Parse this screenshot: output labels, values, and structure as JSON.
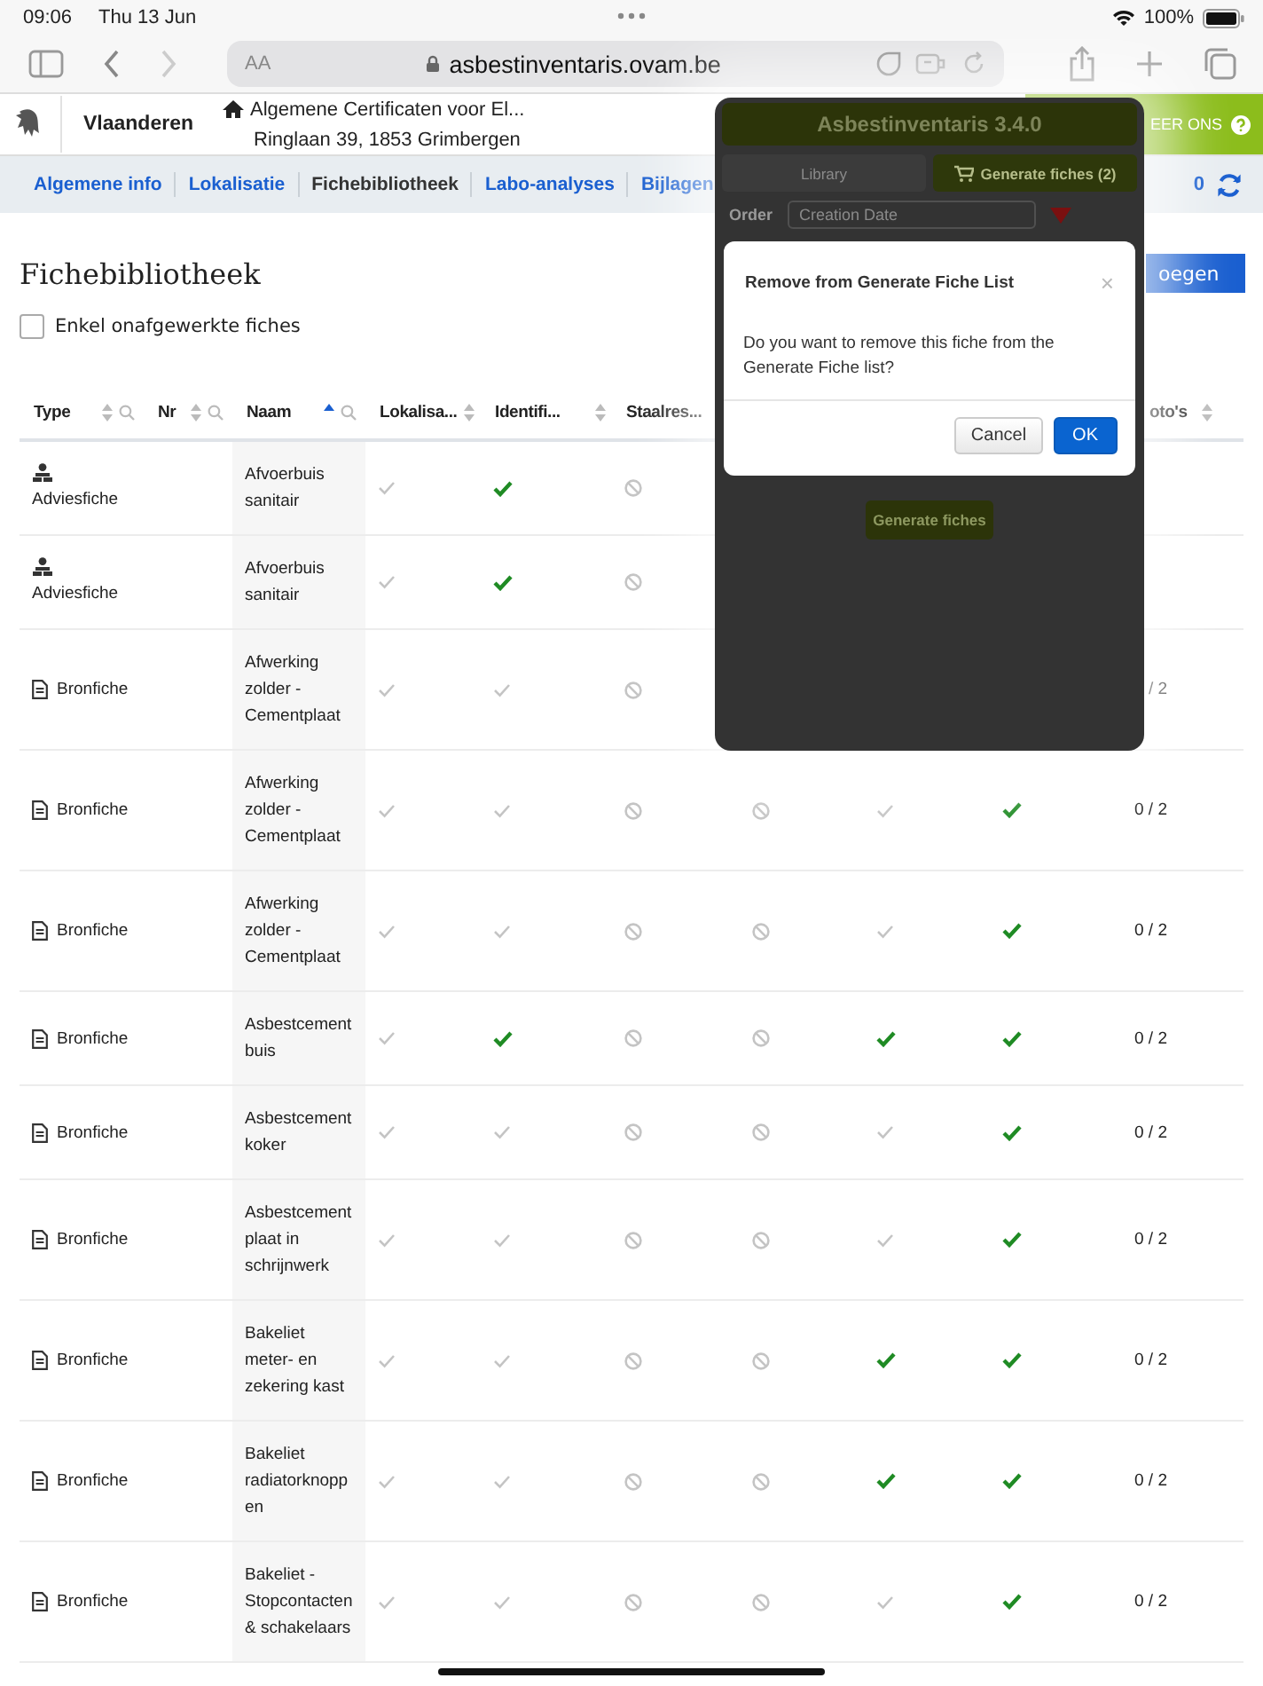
{
  "status_bar": {
    "time": "09:06",
    "date": "Thu 13 Jun",
    "battery": "100%"
  },
  "browser": {
    "text_size_button": "AA",
    "url": "asbestinventaris.ovam.be"
  },
  "site_header": {
    "brand": "Vlaanderen",
    "breadcrumb": [
      "Algemene Certificaten voor El...",
      "Ringlaan 39, 1853 Grimbergen"
    ],
    "contact_button": "EER ONS"
  },
  "tabs": [
    {
      "label": "Algemene info",
      "selected": false
    },
    {
      "label": "Lokalisatie",
      "selected": false
    },
    {
      "label": "Fichebibliotheek",
      "selected": true
    },
    {
      "label": "Labo-analyses",
      "selected": false
    },
    {
      "label": "Bijlagen",
      "selected": false
    }
  ],
  "sync": {
    "count": "0"
  },
  "page": {
    "title": "Fichebibliotheek",
    "add_button": "oegen",
    "filter": {
      "label": "Enkel onafgewerkte fiches",
      "checked": false
    }
  },
  "table": {
    "columns": [
      {
        "label": "Type",
        "sorted": false,
        "search": true
      },
      {
        "label": "Nr",
        "sorted": false,
        "search": true
      },
      {
        "label": "Naam",
        "sorted": true,
        "search": true
      },
      {
        "label": "Lokalisa...",
        "sorted": false,
        "search": false
      },
      {
        "label": "Identifi...",
        "sorted": false,
        "search": false
      },
      {
        "label": "Staalres...",
        "search": false
      },
      {
        "label": "oto's",
        "sorted": false,
        "search": false
      }
    ],
    "rows": [
      {
        "kind": "advies",
        "type": "Adviesfiche",
        "naam": "Afvoerbuis sanitair",
        "marks": [
          {
            "kind": "check",
            "done": false
          },
          {
            "kind": "check",
            "done": true
          },
          {
            "kind": "not_applicable"
          }
        ]
      },
      {
        "kind": "advies",
        "type": "Adviesfiche",
        "naam": "Afvoerbuis sanitair",
        "marks": [
          {
            "kind": "check",
            "done": false
          },
          {
            "kind": "check",
            "done": true
          },
          {
            "kind": "not_applicable"
          }
        ]
      },
      {
        "kind": "bron",
        "type": "Bronfiche",
        "naam": "Afwerking zolder - Cementplaat",
        "marks": [
          {
            "kind": "check",
            "done": false
          },
          {
            "kind": "check",
            "done": false
          },
          {
            "kind": "not_applicable"
          }
        ],
        "fotos": "/ 2"
      },
      {
        "kind": "bron",
        "type": "Bronfiche",
        "naam": "Afwerking zolder - Cementplaat",
        "marks": [
          {
            "kind": "check",
            "done": false
          },
          {
            "kind": "check",
            "done": false
          },
          {
            "kind": "not_applicable"
          },
          {
            "kind": "not_applicable"
          },
          {
            "kind": "check",
            "done": false
          },
          {
            "kind": "check",
            "done": true
          }
        ],
        "fotos": "0 / 2"
      },
      {
        "kind": "bron",
        "type": "Bronfiche",
        "naam": "Afwerking zolder - Cementplaat",
        "marks": [
          {
            "kind": "check",
            "done": false
          },
          {
            "kind": "check",
            "done": false
          },
          {
            "kind": "not_applicable"
          },
          {
            "kind": "not_applicable"
          },
          {
            "kind": "check",
            "done": false
          },
          {
            "kind": "check",
            "done": true
          }
        ],
        "fotos": "0 / 2"
      },
      {
        "kind": "bron",
        "type": "Bronfiche",
        "naam": "Asbestcementbuis",
        "marks": [
          {
            "kind": "check",
            "done": false
          },
          {
            "kind": "check",
            "done": true
          },
          {
            "kind": "not_applicable"
          },
          {
            "kind": "not_applicable"
          },
          {
            "kind": "check",
            "done": true
          },
          {
            "kind": "check",
            "done": true
          }
        ],
        "fotos": "0 / 2"
      },
      {
        "kind": "bron",
        "type": "Bronfiche",
        "naam": "Asbestcementkoker",
        "marks": [
          {
            "kind": "check",
            "done": false
          },
          {
            "kind": "check",
            "done": false
          },
          {
            "kind": "not_applicable"
          },
          {
            "kind": "not_applicable"
          },
          {
            "kind": "check",
            "done": false
          },
          {
            "kind": "check",
            "done": true
          }
        ],
        "fotos": "0 / 2"
      },
      {
        "kind": "bron",
        "type": "Bronfiche",
        "naam": "Asbestcementplaat in schrijnwerk",
        "marks": [
          {
            "kind": "check",
            "done": false
          },
          {
            "kind": "check",
            "done": false
          },
          {
            "kind": "not_applicable"
          },
          {
            "kind": "not_applicable"
          },
          {
            "kind": "check",
            "done": false
          },
          {
            "kind": "check",
            "done": true
          }
        ],
        "fotos": "0 / 2"
      },
      {
        "kind": "bron",
        "type": "Bronfiche",
        "naam": "Bakeliet meter- en zekering kast",
        "marks": [
          {
            "kind": "check",
            "done": false
          },
          {
            "kind": "check",
            "done": false
          },
          {
            "kind": "not_applicable"
          },
          {
            "kind": "not_applicable"
          },
          {
            "kind": "check",
            "done": true
          },
          {
            "kind": "check",
            "done": true
          }
        ],
        "fotos": "0 / 2"
      },
      {
        "kind": "bron",
        "type": "Bronfiche",
        "naam": "Bakeliet radiatorknoppen",
        "marks": [
          {
            "kind": "check",
            "done": false
          },
          {
            "kind": "check",
            "done": false
          },
          {
            "kind": "not_applicable"
          },
          {
            "kind": "not_applicable"
          },
          {
            "kind": "check",
            "done": true
          },
          {
            "kind": "check",
            "done": true
          }
        ],
        "fotos": "0 / 2"
      },
      {
        "kind": "bron",
        "type": "Bronfiche",
        "naam": "Bakeliet - Stopcontacten & schakelaars",
        "marks": [
          {
            "kind": "check",
            "done": false
          },
          {
            "kind": "check",
            "done": false
          },
          {
            "kind": "not_applicable"
          },
          {
            "kind": "not_applicable"
          },
          {
            "kind": "check",
            "done": false
          },
          {
            "kind": "check",
            "done": true
          }
        ],
        "fotos": "0 / 2"
      }
    ]
  },
  "popover": {
    "title": "Asbestinventaris 3.4.0",
    "tabs": [
      {
        "label": "Library",
        "selected": false
      },
      {
        "label": "Generate fiches (2)",
        "selected": true
      }
    ],
    "order_label": "Order",
    "order_value": "Creation Date",
    "generate_button": "Generate fiches"
  },
  "dialog": {
    "title": "Remove from Generate Fiche List",
    "close": "×",
    "message": "Do you want to remove this fiche from the Generate Fiche list?",
    "buttons": [
      {
        "label": "Cancel",
        "kind": "secondary"
      },
      {
        "label": "OK",
        "kind": "primary"
      }
    ]
  }
}
